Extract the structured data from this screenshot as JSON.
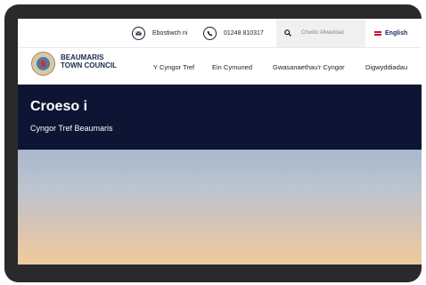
{
  "topbar": {
    "email_label": "Ebostiwch ni",
    "phone": "01248 810317",
    "search_placeholder": "Chwilio Allweddair",
    "language": "English"
  },
  "nav": {
    "brand_line1": "BEAUMARIS",
    "brand_line2": "TOWN COUNCIL",
    "links": [
      "Y Cyngor Tref",
      "Ein Cymuned",
      "Gwasanaethau'r Cyngor",
      "Digwyddiadau"
    ]
  },
  "hero": {
    "title": "Croeso i",
    "subtitle": "Cyngor Tref Beaumaris"
  },
  "colors": {
    "hero_bg": "#0e1433",
    "brand_text": "#1a2a4a"
  }
}
